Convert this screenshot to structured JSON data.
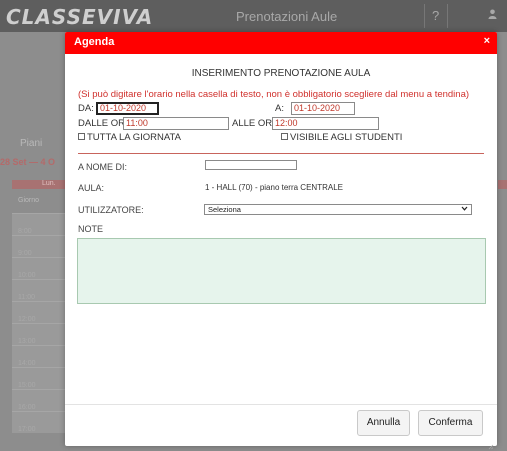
{
  "app": {
    "logo": "CLASSEVIVA",
    "title": "Prenotazioni Aule",
    "help_icon": "?",
    "user_icon": "user-icon"
  },
  "background": {
    "piani_label": "Piani",
    "week_label": "28 Set — 4 O",
    "day_label": "Lun.",
    "giorno_label": "Giorno",
    "times": [
      "8:00",
      "9:00",
      "10:00",
      "11:00",
      "12:00",
      "13:00",
      "14:00",
      "15:00",
      "16:00",
      "17:00"
    ]
  },
  "modal": {
    "title": "Agenda",
    "close_icon": "×",
    "heading": "INSERIMENTO PRENOTAZIONE AULA",
    "hint": "(Si può digitare l'orario nella casella di testo, non è obbligatorio scegliere dal menu a tendina)",
    "da_label": "DA:",
    "da_value": "01-10-2020",
    "a_label": "A:",
    "a_value": "01-10-2020",
    "dalle_ore_label": "DALLE ORE",
    "dalle_ore_value": "11:00",
    "alle_ore_label": "ALLE ORE",
    "alle_ore_value": "12:00",
    "tutta_giornata_label": "TUTTA LA GIORNATA",
    "visibile_studenti_label": "VISIBILE AGLI STUDENTI",
    "a_nome_di_label": "A NOME DI:",
    "aula_label": "AULA:",
    "aula_value": "1 - HALL (70) - piano terra CENTRALE",
    "utilizzatore_label": "UTILIZZATORE:",
    "utilizzatore_selected": "Seleziona",
    "note_label": "NOTE",
    "note_value": "",
    "annulla_label": "Annulla",
    "conferma_label": "Conferma"
  },
  "colors": {
    "accent": "#ff0000",
    "hint_text": "#d0312d",
    "note_bg": "#e6f4ec"
  }
}
